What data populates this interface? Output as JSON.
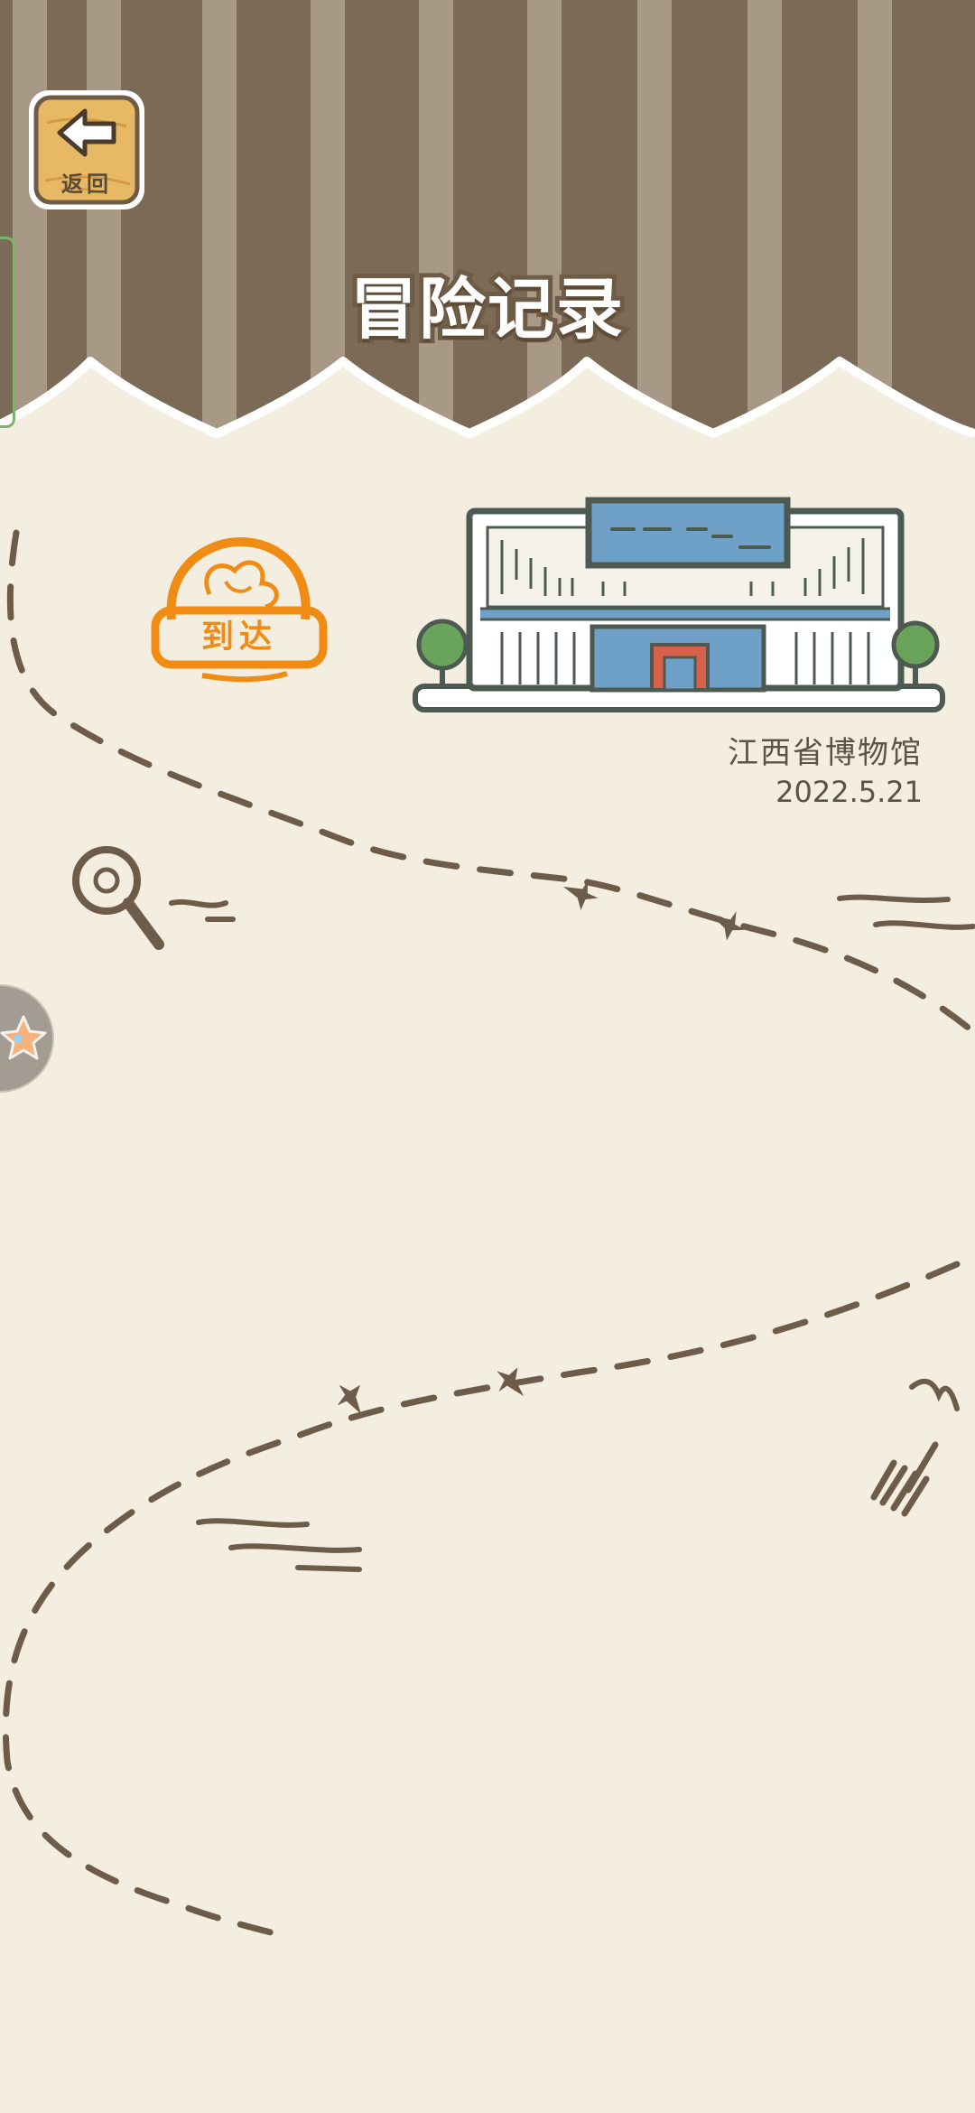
{
  "header": {
    "title": "冒险记录",
    "back_label": "返回"
  },
  "record": {
    "stamp_label": "到达",
    "location": "江西省博物馆",
    "date": "2022.5.21"
  },
  "icons": {
    "back": "arrow-left-icon",
    "floating": "star-icon",
    "trail_decor": [
      "magnifier-icon",
      "fork-icon",
      "footprint-icon"
    ]
  },
  "colors": {
    "stripe_dark": "#7a6a56",
    "stripe_light": "#a89886",
    "paper": "#f3eee0",
    "trail": "#6e5c4a",
    "stamp": "#f08c14",
    "museum_blue": "#6fa0c8",
    "museum_red": "#d9604a",
    "tree": "#6aa35a"
  }
}
